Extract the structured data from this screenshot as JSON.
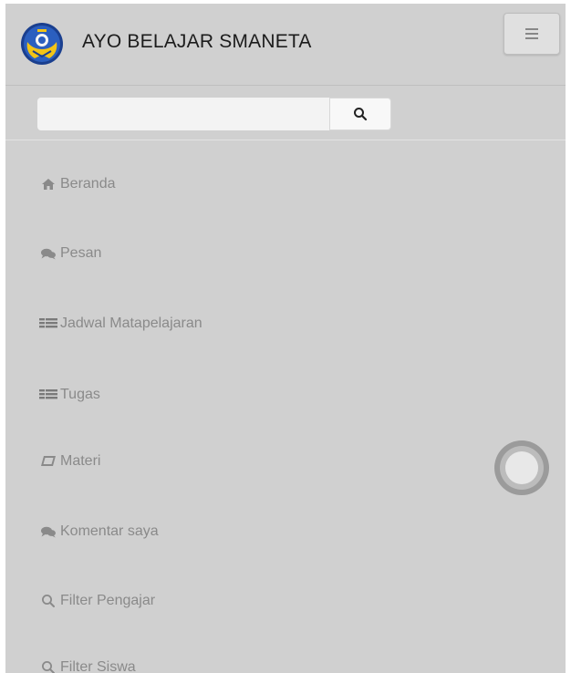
{
  "header": {
    "brand_title": "AYO BELAJAR SMANETA",
    "logo_icon": "school-emblem-icon",
    "toggle_icon": "hamburger-icon"
  },
  "search": {
    "value": "",
    "placeholder": "",
    "button_icon": "search-icon"
  },
  "menu": {
    "items": [
      {
        "label": "Beranda",
        "icon": "home-icon"
      },
      {
        "label": "Pesan",
        "icon": "comments-icon"
      },
      {
        "label": "Jadwal Matapelajaran",
        "icon": "list-icon"
      },
      {
        "label": "Tugas",
        "icon": "list-icon"
      },
      {
        "label": "Materi",
        "icon": "book-icon"
      },
      {
        "label": "Komentar saya",
        "icon": "comments-icon"
      },
      {
        "label": "Filter Pengajar",
        "icon": "search-icon"
      },
      {
        "label": "Filter Siswa",
        "icon": "search-icon"
      }
    ]
  },
  "colors": {
    "background": "#d0d0d0",
    "menu_text": "#8a8a8a",
    "title_text": "#1c1c1c"
  }
}
